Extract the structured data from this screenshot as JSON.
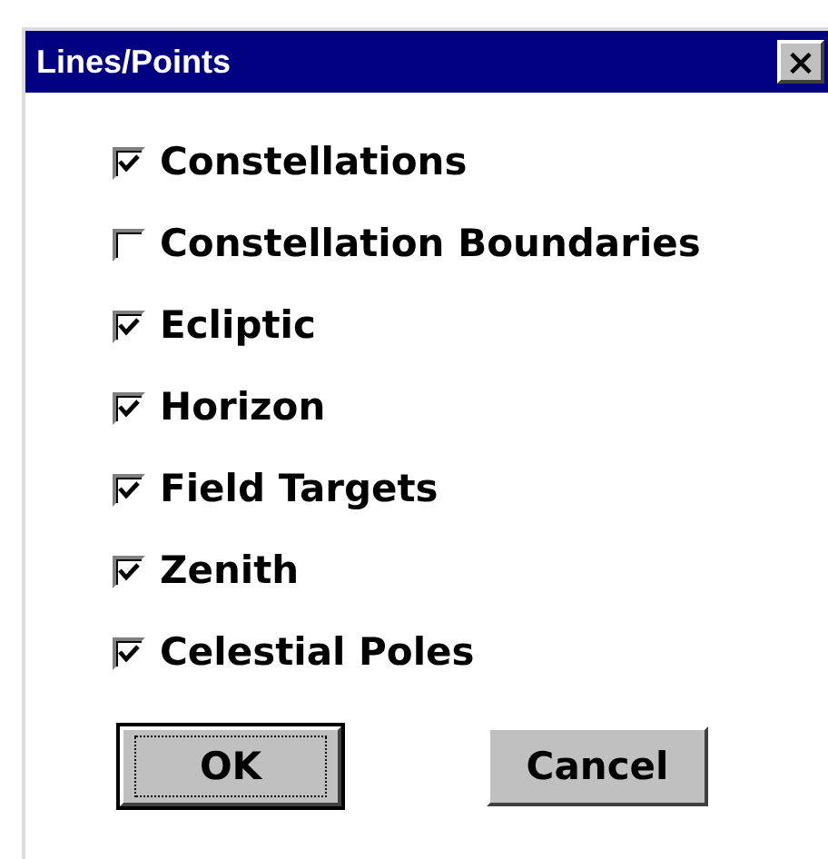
{
  "window": {
    "title": "Lines/Points",
    "close_label": "×"
  },
  "options": [
    {
      "label": "Constellations",
      "checked": true
    },
    {
      "label": "Constellation Boundaries",
      "checked": false
    },
    {
      "label": "Ecliptic",
      "checked": true
    },
    {
      "label": "Horizon",
      "checked": true
    },
    {
      "label": "Field Targets",
      "checked": true
    },
    {
      "label": "Zenith",
      "checked": true
    },
    {
      "label": "Celestial Poles",
      "checked": true
    }
  ],
  "buttons": [
    {
      "label": "OK",
      "default": true
    },
    {
      "label": "Cancel",
      "default": false
    }
  ]
}
